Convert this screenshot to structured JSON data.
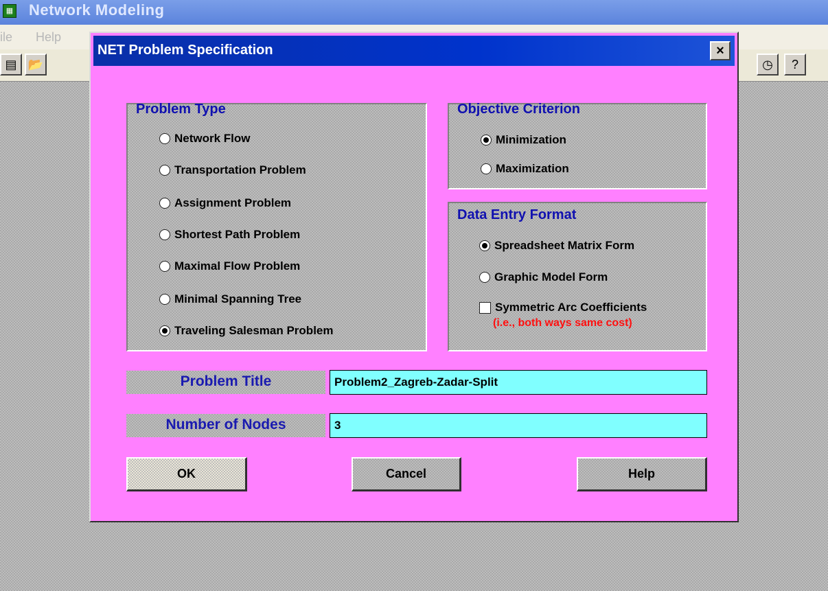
{
  "app": {
    "title": "Network Modeling",
    "menu": [
      "ile",
      "Help"
    ],
    "toolbar_left_icons": [
      "new-icon",
      "open-icon"
    ],
    "toolbar_right_icons": [
      "clock-icon",
      "help-icon"
    ]
  },
  "dialog": {
    "title": "NET Problem Specification",
    "close_label": "×",
    "problem_type": {
      "title": "Problem Type",
      "options": [
        "Network Flow",
        "Transportation Problem",
        "Assignment Problem",
        "Shortest Path Problem",
        "Maximal Flow Problem",
        "Minimal Spanning Tree",
        "Traveling Salesman Problem"
      ],
      "selected": "Traveling Salesman Problem"
    },
    "objective": {
      "title": "Objective Criterion",
      "options": [
        "Minimization",
        "Maximization"
      ],
      "selected": "Minimization"
    },
    "data_entry": {
      "title": "Data Entry Format",
      "options": [
        "Spreadsheet Matrix Form",
        "Graphic Model Form"
      ],
      "selected": "Spreadsheet Matrix Form",
      "checkbox_label": "Symmetric Arc Coefficients",
      "checkbox_checked": false,
      "note": "(i.e., both ways same cost)"
    },
    "problem_title": {
      "label": "Problem Title",
      "value": "Problem2_Zagreb-Zadar-Split"
    },
    "num_nodes": {
      "label": "Number of Nodes",
      "value": "3"
    },
    "buttons": {
      "ok": "OK",
      "cancel": "Cancel",
      "help": "Help"
    }
  }
}
